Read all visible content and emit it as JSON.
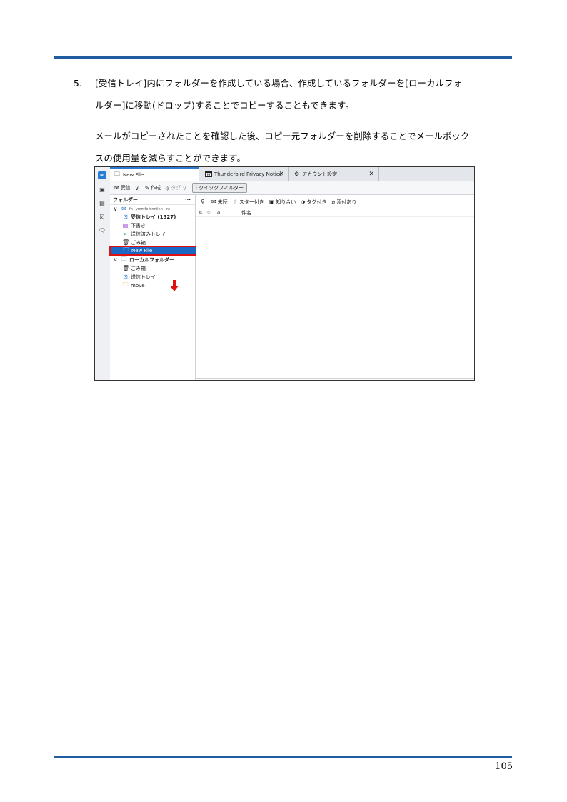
{
  "page": {
    "step_number": "5.",
    "para1_line1": "[受信トレイ]内にフォルダーを作成している場合、作成しているフォルダーを[ローカルフォ",
    "para1_line2": "ルダー]に移動(ドロップ)することでコピーすることもできます。",
    "para2_line1": "メールがコピーされたことを確認した後、コピー元フォルダーを削除することでメールボック",
    "para2_line2": "スの使用量を減らすことができます。",
    "page_number": "105",
    "rule_color": "#1f5da0"
  },
  "screenshot": {
    "tabs": [
      {
        "label": "New File",
        "icon": "folder-icon"
      },
      {
        "label": "Thunderbird Privacy Notice",
        "icon": "m-logo",
        "close": "✕"
      },
      {
        "label": "アカウント設定",
        "icon": "gear-icon",
        "close": "✕"
      }
    ],
    "logo_letter": "m",
    "toolbar": {
      "receive": "受信",
      "compose": "作成",
      "tag": "タグ",
      "quick_filter": "クイックフィルター"
    },
    "folder_pane": {
      "header": "フォルダー",
      "more": "···",
      "account_name": "fh ‐ ymmfo h nniinn—nt",
      "folders": [
        {
          "label": "受信トレイ (1327)",
          "icon": "inbox-icon"
        },
        {
          "label": "下書き",
          "icon": "drafts-icon"
        },
        {
          "label": "送信済みトレイ",
          "icon": "sent-icon"
        },
        {
          "label": "ごみ箱",
          "icon": "trash-icon"
        },
        {
          "label": "New File",
          "icon": "folder-icon"
        }
      ],
      "local_folders": "ローカルフォルダー",
      "local_items": [
        {
          "label": "ごみ箱",
          "icon": "trash-icon"
        },
        {
          "label": "送信トレイ",
          "icon": "outbox-icon"
        },
        {
          "label": "move",
          "icon": "folder-icon"
        }
      ]
    },
    "quick_filter_bar": {
      "unread": "未読",
      "starred": "スター付き",
      "contacts": "知り合い",
      "tagged": "タグ付き",
      "attachments": "添付あり"
    },
    "columns": {
      "subject": "件名"
    },
    "accent_color": "#2a7bd3",
    "selection_color": "#1a67c4",
    "highlight_color": "#e01010"
  }
}
